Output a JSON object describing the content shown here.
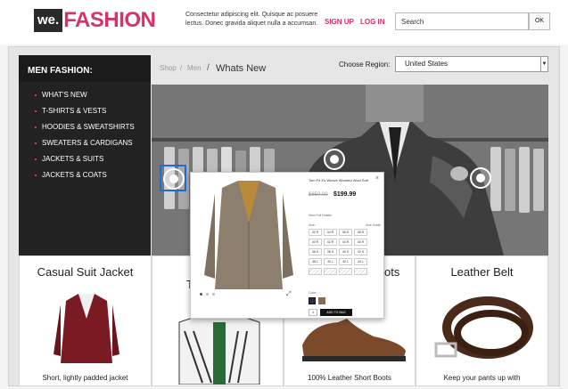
{
  "header": {
    "logo_we": "we.",
    "logo_fashion": "FASHION",
    "tagline": "Consectetur adipiscing elit. Quisque ac posuere lectus. Donec gravida aliquet nulla a accumsan.",
    "sign_up": "SIGN UP",
    "log_in": "LOG IN",
    "search_placeholder": "Search",
    "search_button": "OK"
  },
  "sidebar": {
    "title": "MEN FASHION:",
    "items": [
      {
        "label": "WHAT'S NEW"
      },
      {
        "label": "T-SHIRTS & VESTS"
      },
      {
        "label": "HOODIES & SWEATSHIRTS"
      },
      {
        "label": "SWEATERS & CARDIGANS"
      },
      {
        "label": "JACKETS & SUITS"
      },
      {
        "label": "JACKETS & COATS"
      }
    ]
  },
  "breadcrumb": {
    "shop": "Shop",
    "men": "Men",
    "current": "Whats New",
    "sep": "/"
  },
  "region": {
    "label": "Choose Region:",
    "selected": "United States"
  },
  "cards": [
    {
      "title": "Casual Suit Jacket",
      "caption": "Short, lightly padded jacket"
    },
    {
      "title": "T",
      "caption": ""
    },
    {
      "title": "ots",
      "caption": "100% Leather Short Boots"
    },
    {
      "title": "Leather Belt",
      "caption": "Keep your pants up with"
    }
  ],
  "popup": {
    "close": "×",
    "title": "Tom Fit 3's Weave Worsted Wool Suit",
    "price_old": "$850.00",
    "price_new": "$199.99",
    "view_details": "View Full Details",
    "size_label": "Size:",
    "size_guide": "Size Guide",
    "sizes": [
      "32 R",
      "34 R",
      "36 R",
      "38 R",
      "40 R",
      "42 R",
      "44 R",
      "46 R",
      "36 S",
      "38 S",
      "40 S",
      "42 S",
      "38 L",
      "40 L",
      "42 L",
      "44 L",
      "46 L",
      "48 L",
      "",
      "",
      "",
      "",
      "",
      ""
    ],
    "color_label": "Color:",
    "qty": "1",
    "add_to_bag": "ADD TO BAG"
  },
  "colors": {
    "brand_pink": "#d8326b",
    "sidebar_bg": "#222222",
    "hotspot_frame": "#1f6bd6"
  }
}
